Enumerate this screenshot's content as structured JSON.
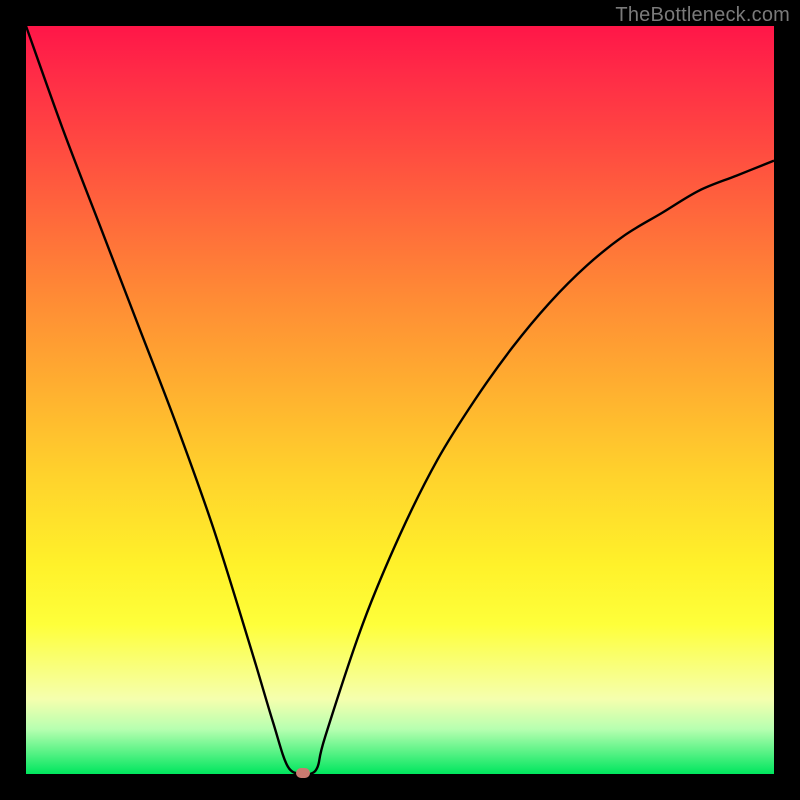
{
  "watermark": "TheBottleneck.com",
  "colors": {
    "frame": "#000000",
    "curve": "#000000",
    "marker": "#c97a70",
    "gradient_stops": [
      "#ff1648",
      "#ff2a47",
      "#ff4342",
      "#ff6a3b",
      "#ff8a35",
      "#ffae30",
      "#ffd22c",
      "#fff12a",
      "#feff3a",
      "#f5ffae",
      "#b7ffb0",
      "#00e65e"
    ]
  },
  "chart_data": {
    "type": "line",
    "title": "",
    "xlabel": "",
    "ylabel": "",
    "xlim": [
      0,
      100
    ],
    "ylim": [
      0,
      100
    ],
    "series": [
      {
        "name": "bottleneck-curve",
        "x": [
          0,
          5,
          10,
          15,
          20,
          25,
          30,
          33,
          35,
          37,
          38,
          39,
          40,
          45,
          50,
          55,
          60,
          65,
          70,
          75,
          80,
          85,
          90,
          95,
          100
        ],
        "values": [
          100,
          86,
          73,
          60,
          47,
          33,
          17,
          7,
          1,
          0,
          0,
          1,
          5,
          20,
          32,
          42,
          50,
          57,
          63,
          68,
          72,
          75,
          78,
          80,
          82
        ]
      }
    ],
    "annotations": [
      {
        "name": "minimum-marker",
        "x": 37,
        "y": 0
      }
    ]
  }
}
